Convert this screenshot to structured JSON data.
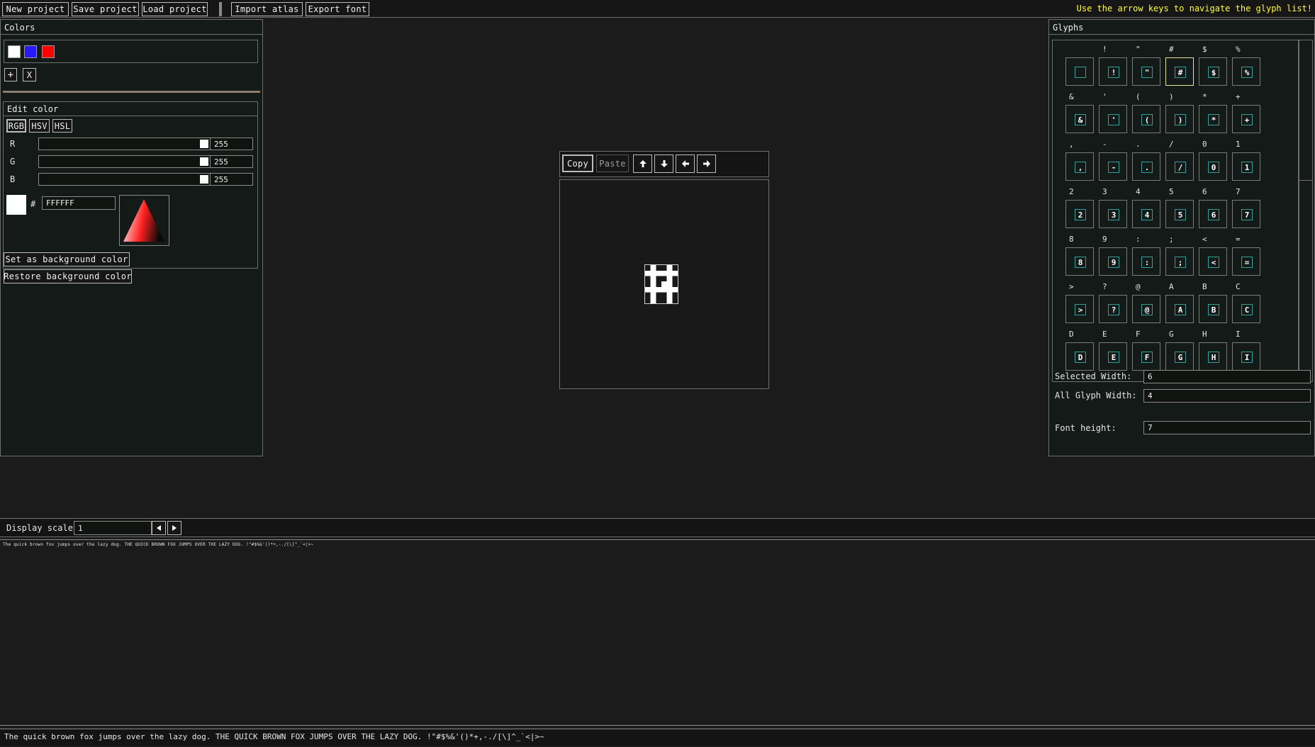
{
  "toolbar": {
    "new_project": "New project",
    "save_project": "Save project",
    "load_project": "Load project",
    "import_atlas": "Import atlas",
    "export_font": "Export font",
    "hint": "Use the arrow keys to navigate the glyph list!"
  },
  "colors_panel": {
    "title": "Colors",
    "swatches": [
      "#ffffff",
      "#2a18ff",
      "#ff0000"
    ],
    "add_label": "+",
    "remove_label": "X"
  },
  "edit_color": {
    "title": "Edit color",
    "modes": [
      "RGB",
      "HSV",
      "HSL"
    ],
    "channels": [
      {
        "label": "R",
        "value": "255"
      },
      {
        "label": "G",
        "value": "255"
      },
      {
        "label": "B",
        "value": "255"
      }
    ],
    "hash": "#",
    "hex_value": "FFFFFF",
    "preview_color": "#ffffff"
  },
  "buttons": {
    "set_bg": "Set as background color",
    "restore_bg": "Restore background color"
  },
  "editor": {
    "copy": "Copy",
    "paste": "Paste",
    "up_icon": "arrow-up-icon",
    "down_icon": "arrow-down-icon",
    "left_icon": "arrow-left-icon",
    "right_icon": "arrow-right-icon",
    "current_glyph": "#"
  },
  "glyphs_panel": {
    "title": "Glyphs",
    "rows": [
      [
        " ",
        "!",
        "\"",
        "#",
        "$",
        "%"
      ],
      [
        "&",
        "'",
        "(",
        ")",
        "*",
        "+"
      ],
      [
        ",",
        "-",
        ".",
        "/",
        "0",
        "1"
      ],
      [
        "2",
        "3",
        "4",
        "5",
        "6",
        "7"
      ],
      [
        "8",
        "9",
        ":",
        ";",
        "<",
        "="
      ],
      [
        ">",
        "?",
        "@",
        "A",
        "B",
        "C"
      ],
      [
        "D",
        "E",
        "F",
        "G",
        "H",
        "I"
      ]
    ],
    "selected_width_label": "Selected Width:",
    "selected_width_value": "6",
    "all_glyph_width_label": "All Glyph Width:",
    "all_glyph_width_value": "4",
    "font_height_label": "Font height:",
    "font_height_value": "7"
  },
  "display": {
    "scale_label": "Display scale",
    "scale_value": "1",
    "prev_icon": "triangle-left-icon",
    "next_icon": "triangle-right-icon",
    "preview_small": "The quick brown fox jumps over the lazy dog. THE QUICK BROWN FOX JUMPS OVER THE LAZY DOG. !\"#$%&'()*+,-./[\\]^_`<|>~",
    "preview_input": "The quick brown fox jumps over the lazy dog. THE QUICK BROWN FOX JUMPS OVER THE LAZY DOG. !\"#$%&'()*+,-./[\\]^_`<|>~"
  },
  "colors": {
    "accent_yellow": "#ffff33",
    "selected_border": "#e8e3a0",
    "glyph_border": "#2f9fa0"
  }
}
